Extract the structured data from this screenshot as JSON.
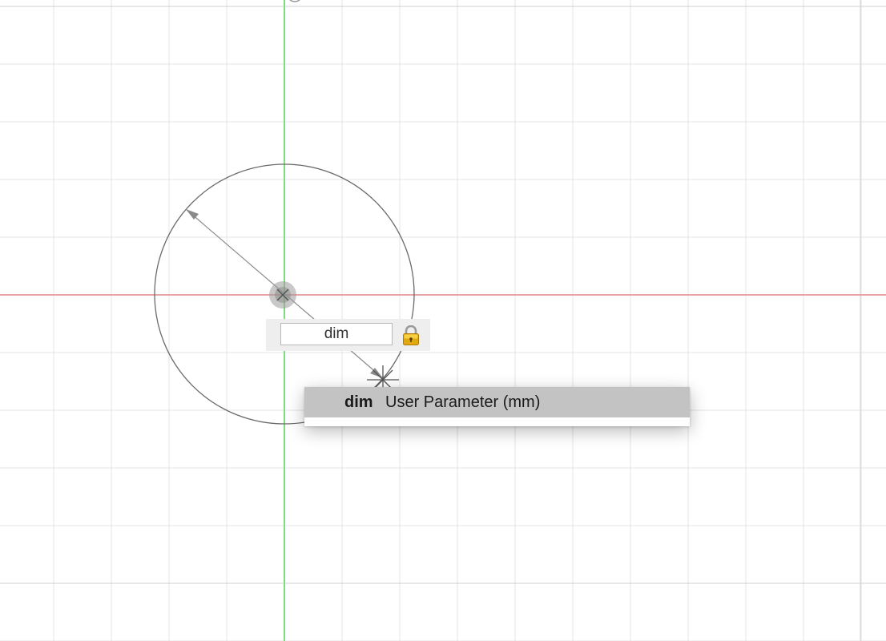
{
  "dimension_input": {
    "value": "dim",
    "locked": true,
    "lock_icon": "lock-icon"
  },
  "autocomplete": {
    "items": [
      {
        "name": "dim",
        "description": "User Parameter (mm)",
        "selected": true
      }
    ]
  },
  "sketch": {
    "axis_colors": {
      "horizontal": "#e3a3a3",
      "vertical": "#73dd73"
    },
    "grid_color": "#e2e2e2",
    "geometry_color": "#6c6c6c"
  }
}
